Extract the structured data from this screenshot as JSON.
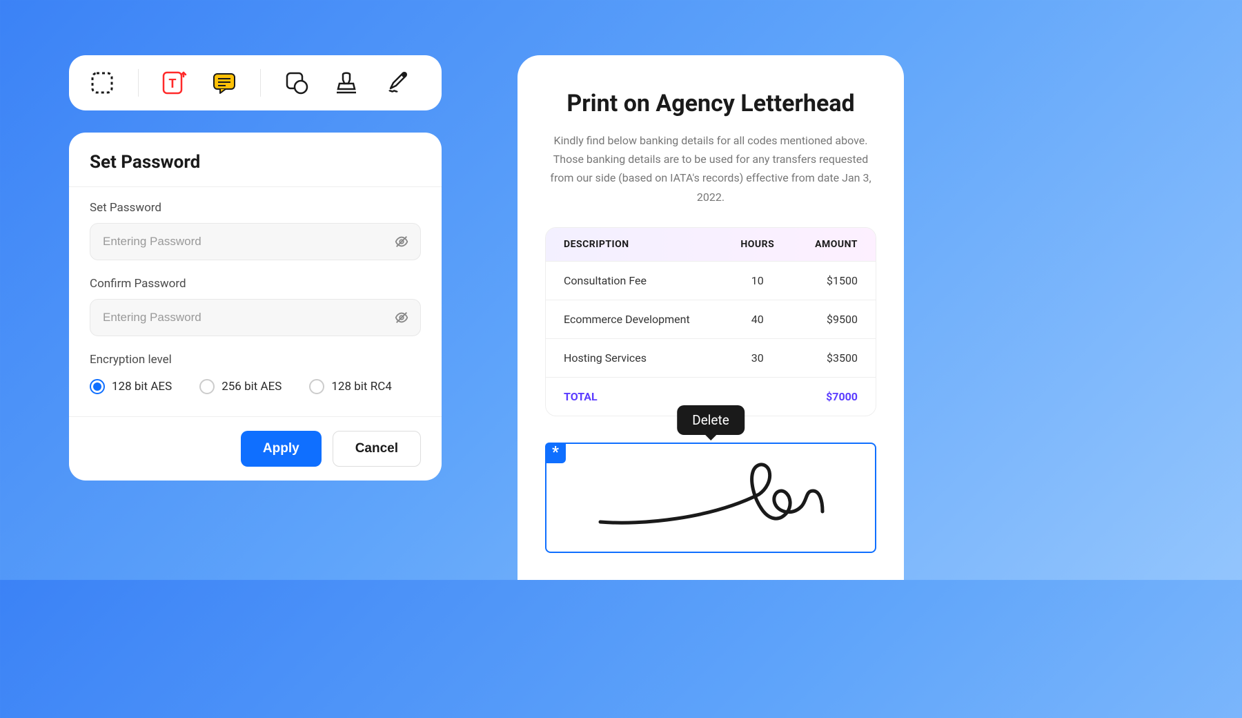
{
  "toolbar": {
    "icons": [
      "selection",
      "text",
      "comment",
      "image-shape",
      "stamp",
      "signature-pen"
    ]
  },
  "password": {
    "title": "Set Password",
    "set_label": "Set Password",
    "set_placeholder": "Entering Password",
    "confirm_label": "Confirm Password",
    "confirm_placeholder": "Entering Password",
    "encryption_label": "Encryption level",
    "options": [
      {
        "label": "128 bit AES",
        "selected": true
      },
      {
        "label": "256 bit AES",
        "selected": false
      },
      {
        "label": "128 bit RC4",
        "selected": false
      }
    ],
    "apply": "Apply",
    "cancel": "Cancel"
  },
  "document": {
    "title": "Print on Agency Letterhead",
    "intro": "Kindly find below banking details for all codes mentioned above. Those banking details are to be used for any transfers requested from our side (based on IATA's records) effective from date Jan 3, 2022.",
    "columns": {
      "desc": "DESCRIPTION",
      "hours": "HOURS",
      "amount": "AMOUNT"
    },
    "rows": [
      {
        "desc": "Consultation Fee",
        "hours": "10",
        "amount": "$1500"
      },
      {
        "desc": "Ecommerce Development",
        "hours": "40",
        "amount": "$9500"
      },
      {
        "desc": "Hosting Services",
        "hours": "30",
        "amount": "$3500"
      }
    ],
    "total_label": "TOTAL",
    "total_amount": "$7000",
    "tooltip": "Delete",
    "required_mark": "*"
  }
}
